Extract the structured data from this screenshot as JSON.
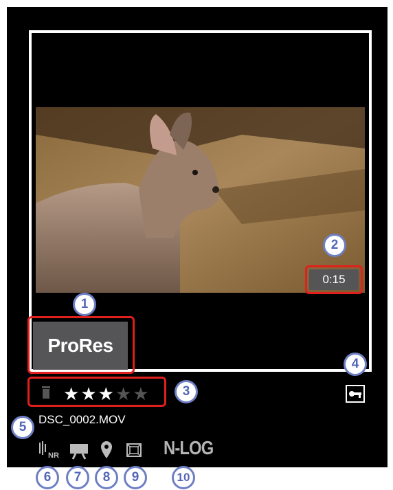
{
  "thumbnail": {
    "format_badge": "ProRes",
    "duration": "0:15",
    "rating": {
      "filled": 3,
      "total": 5
    },
    "filename": "DSC_0002.MOV"
  },
  "status_icons": {
    "noise_reduction": "NR",
    "log_label": "N-LOG"
  },
  "icons": [
    "trash-icon",
    "key-lock-icon",
    "noise-reduction-icon",
    "movie-camera-icon",
    "location-pin-icon",
    "frame-icon"
  ],
  "callouts": [
    "1",
    "2",
    "3",
    "4",
    "5",
    "6",
    "7",
    "8",
    "9",
    "10"
  ],
  "colors": {
    "highlight": "#e0201c",
    "callout": "#6e7fc4",
    "badge_bg": "#555557"
  }
}
